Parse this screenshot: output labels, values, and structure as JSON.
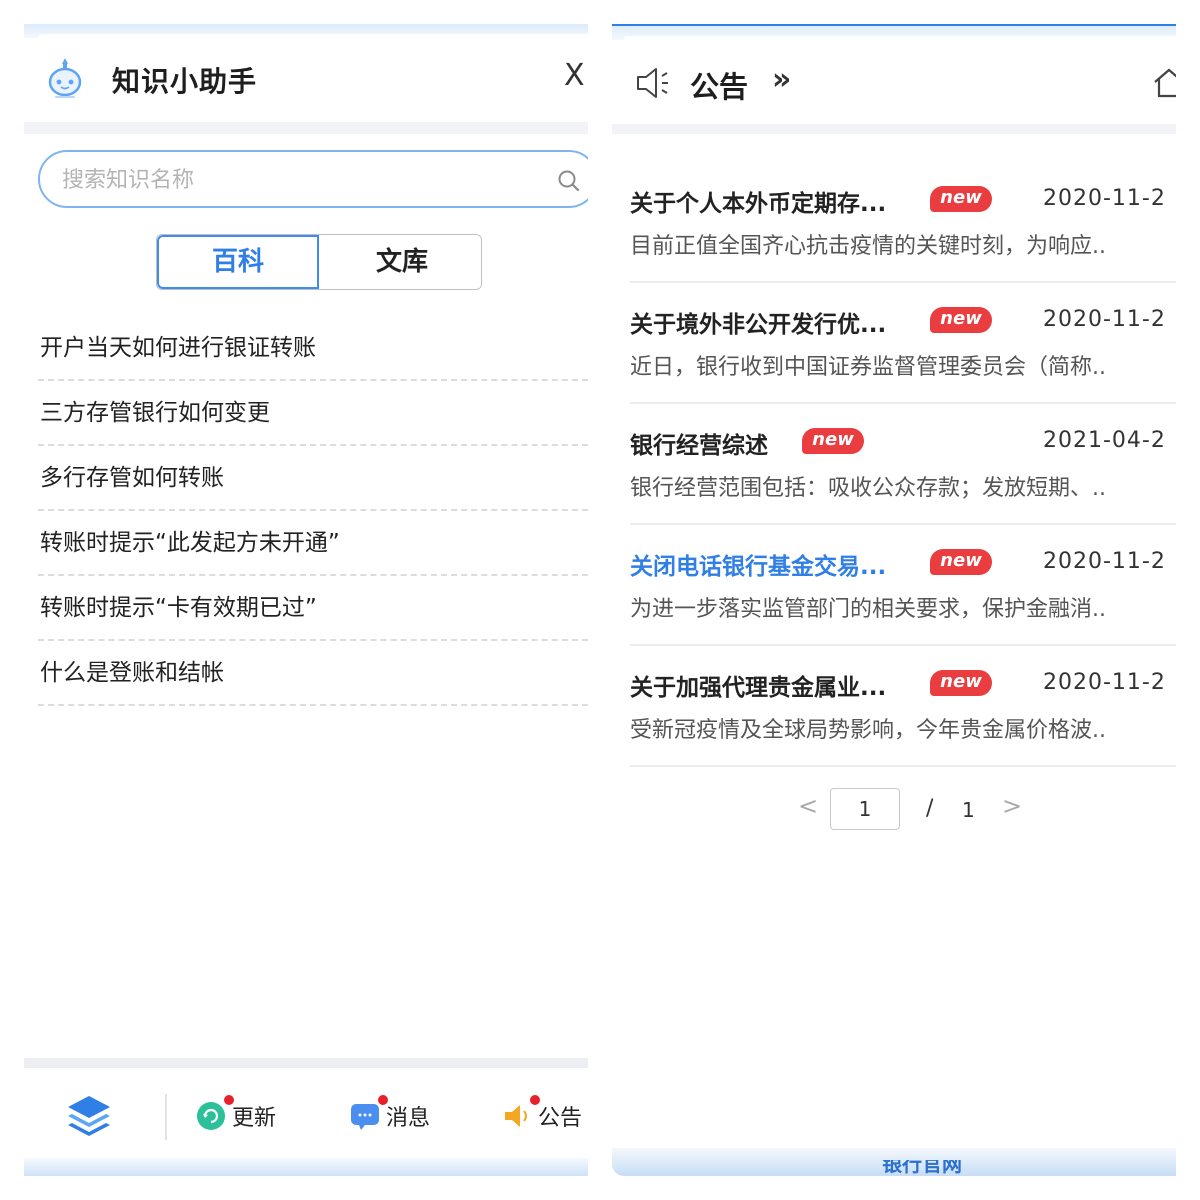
{
  "knowledge_panel": {
    "title": "知识小助手",
    "close_label": "X",
    "search": {
      "placeholder": "搜索知识名称",
      "value": ""
    },
    "tabs": [
      {
        "label": "百科",
        "active": true
      },
      {
        "label": "文库",
        "active": false
      }
    ],
    "faq_items": [
      "开户当天如何进行银证转账",
      "三方存管银行如何变更",
      "多行存管如何转账",
      "转账时提示“此发起方未开通”",
      "转账时提示“卡有效期已过”",
      "什么是登账和结帐"
    ],
    "footer": {
      "items": [
        {
          "label": "更新",
          "icon": "refresh-icon",
          "color": "#2bbf9a",
          "has_dot": true
        },
        {
          "label": "消息",
          "icon": "message-icon",
          "color": "#4a8ef0",
          "has_dot": true
        },
        {
          "label": "公告",
          "icon": "speaker-icon",
          "color": "#f5a623",
          "has_dot": true
        }
      ],
      "layers_icon": "layers-icon"
    }
  },
  "notice_panel": {
    "title": "公告",
    "more_label": "»",
    "notices": [
      {
        "title": "关于个人本外币定期存...",
        "badge": "new",
        "date": "2020-11-2",
        "summary": "目前正值全国齐心抗击疫情的关键时刻，为响应..",
        "highlighted": false
      },
      {
        "title": "关于境外非公开发行优...",
        "badge": "new",
        "date": "2020-11-2",
        "summary": "近日，银行收到中国证券监督管理委员会（简称..",
        "highlighted": false
      },
      {
        "title": "银行经营综述",
        "badge": "new",
        "date": "2021-04-2",
        "summary": "银行经营范围包括：吸收公众存款；发放短期、..",
        "highlighted": false
      },
      {
        "title": "关闭电话银行基金交易...",
        "badge": "new",
        "date": "2020-11-2",
        "summary": "为进一步落实监管部门的相关要求，保护金融消..",
        "highlighted": true
      },
      {
        "title": "关于加强代理贵金属业...",
        "badge": "new",
        "date": "2020-11-2",
        "summary": "受新冠疫情及全球局势影响，今年贵金属价格波..",
        "highlighted": false
      }
    ],
    "pager": {
      "prev": "<",
      "current": "1",
      "separator": "/",
      "total": "1",
      "next": ">"
    },
    "bottom_text": "银行官网"
  },
  "colors": {
    "accent": "#2f7fe6",
    "badge": "#ea3d3f",
    "dot": "#e8202c"
  }
}
